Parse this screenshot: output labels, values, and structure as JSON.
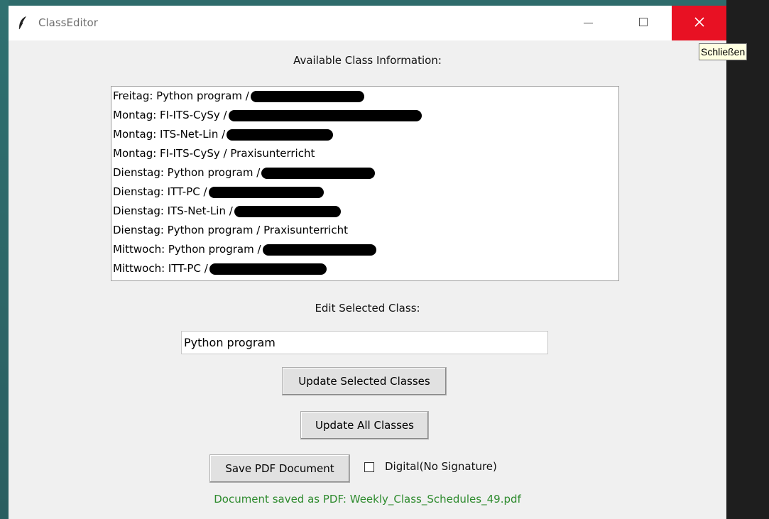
{
  "window": {
    "title": "ClassEditor",
    "close_tooltip": "Schließen"
  },
  "main": {
    "available_label": "Available Class Information:",
    "classes": [
      "Freitag: Python program /",
      "Montag: FI-ITS-CySy /",
      "Montag: ITS-Net-Lin /",
      "Montag: FI-ITS-CySy / Praxisunterricht",
      "Dienstag: Python program /",
      "Dienstag: ITT-PC /",
      "Dienstag: ITS-Net-Lin /",
      "Dienstag: Python program / Praxisunterricht",
      "Mittwoch: Python program /",
      "Mittwoch: ITT-PC /"
    ],
    "edit_label": "Edit Selected Class:",
    "edit_value": "Python program",
    "update_selected_label": "Update Selected Classes",
    "update_all_label": "Update All Classes",
    "save_pdf_label": "Save PDF Document",
    "digital_label": "Digital(No Signature)",
    "digital_checked": false,
    "status_text": "Document saved as PDF: Weekly_Class_Schedules_49.pdf",
    "status_color": "#2e8b2e"
  },
  "icons": {
    "app": "feather-icon",
    "minimize": "minimize-icon",
    "maximize": "maximize-icon",
    "close": "close-icon"
  }
}
